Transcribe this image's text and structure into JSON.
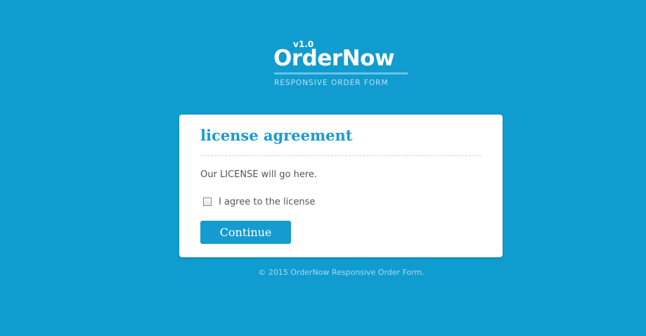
{
  "logo": {
    "version": "v1.0",
    "name": "OrderNow",
    "tagline": "RESPONSIVE ORDER FORM"
  },
  "card": {
    "title": "license agreement",
    "body": "Our LICENSE will go here.",
    "agree_label": "I agree to the license",
    "agree_checked": false,
    "continue_label": "Continue"
  },
  "footer": {
    "copyright": "© 2015 OrderNow Responsive Order Form."
  },
  "colors": {
    "background": "#119ccf",
    "accent": "#1a9bd0",
    "card": "#ffffff"
  }
}
